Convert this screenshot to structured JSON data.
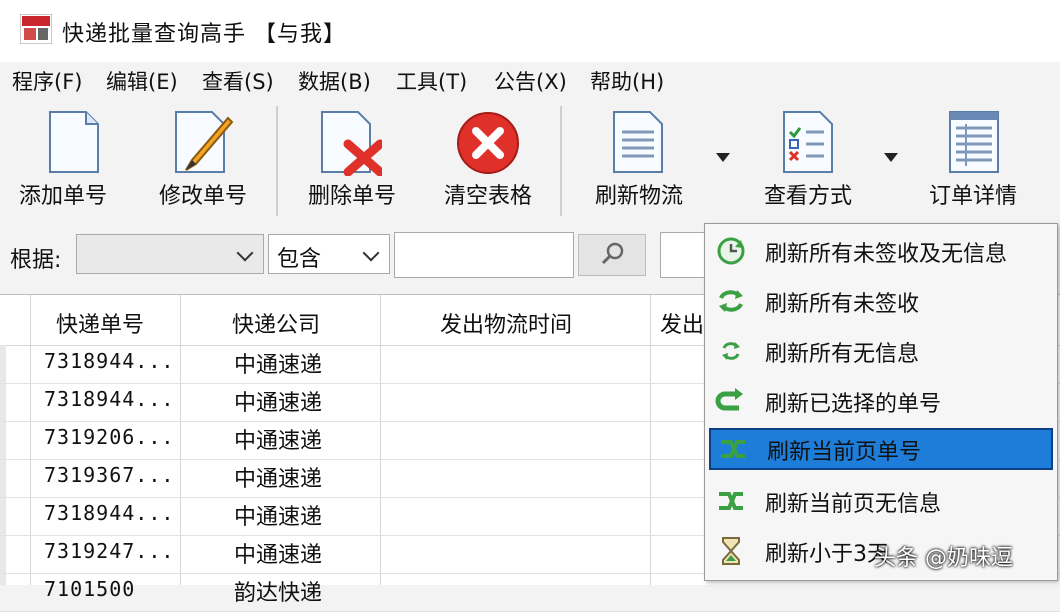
{
  "window": {
    "title": "快递批量查询高手 【与我】"
  },
  "menu": [
    "程序(F)",
    "编辑(E)",
    "查看(S)",
    "数据(B)",
    "工具(T)",
    "公告(X)",
    "帮助(H)"
  ],
  "toolbar": {
    "add": "添加单号",
    "edit": "修改单号",
    "delete": "删除单号",
    "clear": "清空表格",
    "refresh": "刷新物流",
    "view_mode": "查看方式",
    "details": "订单详情"
  },
  "filter": {
    "label": "根据:",
    "field_value": "",
    "match_value": "包含",
    "keyword": ""
  },
  "table": {
    "columns": [
      "快递单号",
      "快递公司",
      "发出物流时间",
      "发出"
    ],
    "rows": [
      {
        "no": "7318944...",
        "company": "中通速递"
      },
      {
        "no": "7318944...",
        "company": "中通速递"
      },
      {
        "no": "7319206...",
        "company": "中通速递"
      },
      {
        "no": "7319367...",
        "company": "中通速递"
      },
      {
        "no": "7318944...",
        "company": "中通速递"
      },
      {
        "no": "7319247...",
        "company": "中通速递"
      },
      {
        "no": "7101500",
        "company": "韵达快递"
      }
    ]
  },
  "refresh_menu": [
    {
      "label": "刷新所有未签收及无信息",
      "icon": "refresh-clock-icon"
    },
    {
      "label": "刷新所有未签收",
      "icon": "refresh-arrows-icon"
    },
    {
      "label": "刷新所有无信息",
      "icon": "refresh-small-icon"
    },
    {
      "label": "刷新已选择的单号",
      "icon": "refresh-selected-icon"
    },
    {
      "label": "刷新当前页单号",
      "icon": "refresh-page-icon",
      "selected": true
    },
    {
      "label": "刷新当前页无信息",
      "icon": "refresh-page-empty-icon"
    },
    {
      "label": "刷新小于3天",
      "icon": "hourglass-icon"
    }
  ],
  "watermark": "头条 @奶味逗",
  "colors": {
    "selection": "#1e7dd8",
    "delete_red": "#e0302a",
    "refresh_green": "#3aa043"
  }
}
